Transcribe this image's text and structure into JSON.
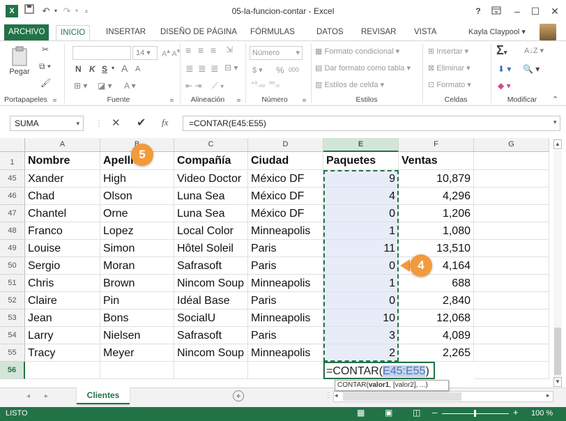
{
  "window": {
    "title": "05-la-funcion-contar - Excel",
    "help": "?",
    "user": "Kayla Claypool ▾"
  },
  "tabs": [
    "ARCHIVO",
    "INICIO",
    "INSERTAR",
    "DISEÑO DE PÁGINA",
    "FÓRMULAS",
    "DATOS",
    "REVISAR",
    "VISTA"
  ],
  "ribbon": {
    "clipboard": {
      "paste": "Pegar",
      "label": "Portapapeles"
    },
    "font": {
      "size": "14",
      "bold": "N",
      "italic": "K",
      "underline": "S",
      "grow": "A",
      "shrink": "A",
      "label": "Fuente"
    },
    "alignment": {
      "label": "Alineación"
    },
    "number": {
      "format": "Número",
      "currency": "$",
      "percent": "%",
      "thousands": "000",
      "dec_inc": "⁺⁰.₀₀",
      "dec_dec": "⁰⁰.₀",
      "label": "Número"
    },
    "styles": {
      "conditional": "Formato condicional",
      "as_table": "Dar formato como tabla",
      "cell_styles": "Estilos de celda",
      "label": "Estilos"
    },
    "cells": {
      "insert": "Insertar",
      "delete": "Eliminar",
      "format": "Formato",
      "label": "Celdas"
    },
    "editing": {
      "sum": "Σ",
      "label": "Modificar"
    }
  },
  "formula_bar": {
    "name_box": "SUMA",
    "fx": "fx",
    "formula": "=CONTAR(E45:E55)"
  },
  "columns": [
    "A",
    "B",
    "C",
    "D",
    "E",
    "F",
    "G"
  ],
  "header_row": {
    "num": "1",
    "cells": [
      "Nombre",
      "Apellido",
      "Compañía",
      "Ciudad",
      "Paquetes",
      "Ventas"
    ]
  },
  "rows": [
    {
      "num": "45",
      "cells": [
        "Xander",
        "High",
        "Video Doctor",
        "México DF",
        "9",
        "10,879"
      ]
    },
    {
      "num": "46",
      "cells": [
        "Chad",
        "Olson",
        "Luna Sea",
        "México DF",
        "4",
        "4,296"
      ]
    },
    {
      "num": "47",
      "cells": [
        "Chantel",
        "Orne",
        "Luna Sea",
        "México DF",
        "0",
        "1,206"
      ]
    },
    {
      "num": "48",
      "cells": [
        "Franco",
        "Lopez",
        "Local Color",
        "Minneapolis",
        "1",
        "1,080"
      ]
    },
    {
      "num": "49",
      "cells": [
        "Louise",
        "Simon",
        "Hôtel Soleil",
        "Paris",
        "11",
        "13,510"
      ]
    },
    {
      "num": "50",
      "cells": [
        "Sergio",
        "Moran",
        "Safrasoft",
        "Paris",
        "0",
        "4,164"
      ]
    },
    {
      "num": "51",
      "cells": [
        "Chris",
        "Brown",
        "Nincom Soup",
        "Minneapolis",
        "1",
        "688"
      ]
    },
    {
      "num": "52",
      "cells": [
        "Claire",
        "Pin",
        "Idéal Base",
        "Paris",
        "0",
        "2,840"
      ]
    },
    {
      "num": "53",
      "cells": [
        "Jean",
        "Bons",
        "SocialU",
        "Minneapolis",
        "10",
        "12,068"
      ]
    },
    {
      "num": "54",
      "cells": [
        "Larry",
        "Nielsen",
        "Safrasoft",
        "Paris",
        "3",
        "4,089"
      ]
    },
    {
      "num": "55",
      "cells": [
        "Tracy",
        "Meyer",
        "Nincom Soup",
        "Minneapolis",
        "2",
        "2,265"
      ]
    }
  ],
  "active_row": {
    "num": "56",
    "formula_prefix": "=CONTAR(",
    "formula_ref": "E45:E55",
    "formula_suffix": ")"
  },
  "tooltip": {
    "func": "CONTAR(",
    "arg1": "valor1",
    "rest": ", [valor2], ...)"
  },
  "sheet": {
    "tab": "Clientes",
    "add": "+"
  },
  "status": {
    "mode": "LISTO",
    "zoom": "100 %"
  },
  "callouts": {
    "five": "5",
    "four": "4"
  },
  "colors": {
    "excel_green": "#217346",
    "callout_orange": "#f39a3c",
    "selection_fill": "#e8ecf8",
    "ref_blue": "#4a78c2"
  }
}
